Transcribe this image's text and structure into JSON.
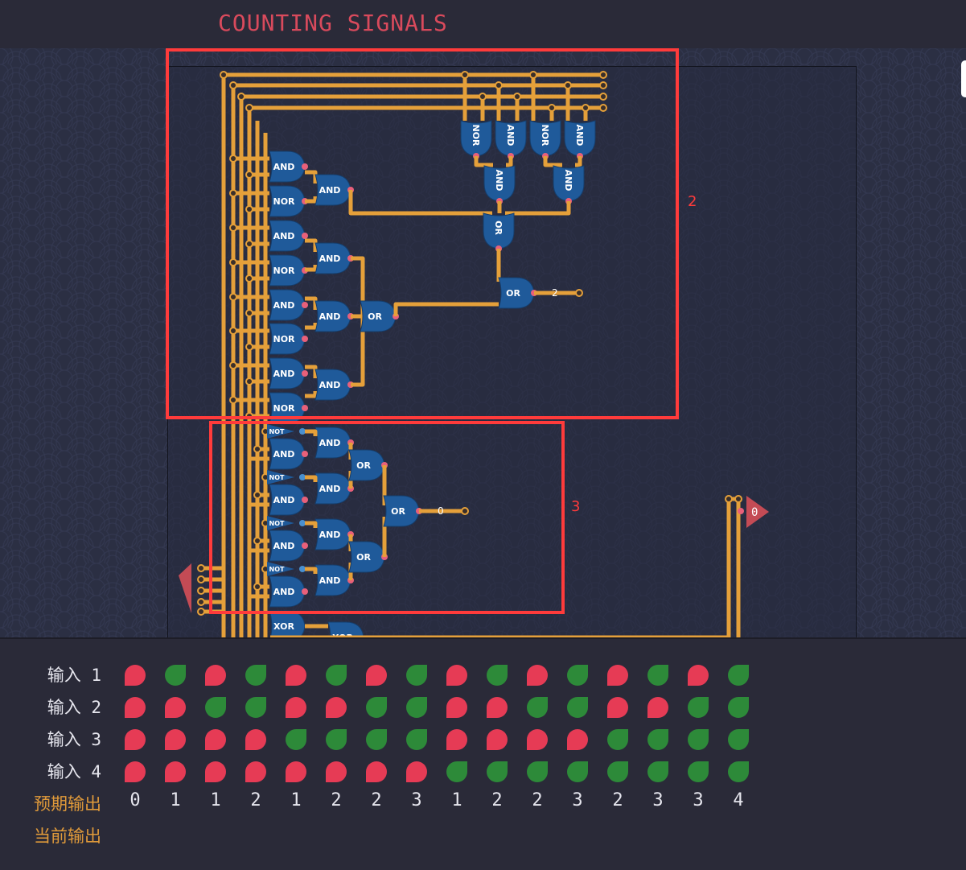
{
  "title": "COUNTING SIGNALS",
  "annotations": [
    {
      "label": "2"
    },
    {
      "label": "3"
    }
  ],
  "circuit": {
    "output_labels": [
      "2",
      "0",
      "0"
    ],
    "gate_labels": {
      "and": "AND",
      "nor": "NOR",
      "or": "OR",
      "not": "NOT",
      "xor": "XOR"
    }
  },
  "truth_table": {
    "rows": [
      {
        "label": "输入 1",
        "values": [
          0,
          1,
          0,
          1,
          0,
          1,
          0,
          1,
          0,
          1,
          0,
          1,
          0,
          1,
          0,
          1
        ]
      },
      {
        "label": "输入 2",
        "values": [
          0,
          0,
          1,
          1,
          0,
          0,
          1,
          1,
          0,
          0,
          1,
          1,
          0,
          0,
          1,
          1
        ]
      },
      {
        "label": "输入 3",
        "values": [
          0,
          0,
          0,
          0,
          1,
          1,
          1,
          1,
          0,
          0,
          0,
          0,
          1,
          1,
          1,
          1
        ]
      },
      {
        "label": "输入 4",
        "values": [
          0,
          0,
          0,
          0,
          0,
          0,
          0,
          0,
          1,
          1,
          1,
          1,
          1,
          1,
          1,
          1
        ]
      }
    ],
    "expected_label": "预期输出",
    "expected": [
      "0",
      "1",
      "1",
      "2",
      "1",
      "2",
      "2",
      "3",
      "1",
      "2",
      "2",
      "3",
      "2",
      "3",
      "3",
      "4"
    ],
    "current_label": "当前输出"
  },
  "colors": {
    "wire": "#e5a03a",
    "gate": "#1f5a9a",
    "on": "#2d8a39",
    "off": "#e63b55",
    "accent": "#d94a5c",
    "annotation": "#ff3b3b"
  }
}
